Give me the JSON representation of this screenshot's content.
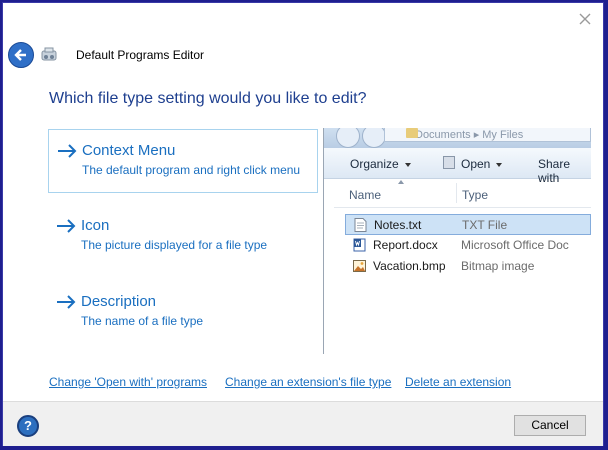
{
  "window": {
    "title": "Default Programs Editor",
    "heading": "Which file type setting would you like to edit?"
  },
  "options": [
    {
      "title": "Context Menu",
      "desc": "The default program and right click menu"
    },
    {
      "title": "Icon",
      "desc": "The picture displayed for a file type"
    },
    {
      "title": "Description",
      "desc": "The name of a file type"
    }
  ],
  "preview": {
    "address": "Documents ▸ My Files",
    "toolbar": {
      "organize": "Organize",
      "open": "Open",
      "share": "Share with"
    },
    "columns": {
      "name": "Name",
      "type": "Type"
    },
    "files": [
      {
        "name": "Notes.txt",
        "type": "TXT File",
        "icon": "text-file-icon"
      },
      {
        "name": "Report.docx",
        "type": "Microsoft Office Doc",
        "icon": "word-doc-icon"
      },
      {
        "name": "Vacation.bmp",
        "type": "Bitmap image",
        "icon": "bitmap-image-icon"
      }
    ]
  },
  "links": {
    "open_with": "Change 'Open with' programs",
    "extension_type": "Change an extension's file type",
    "delete_ext": "Delete an extension"
  },
  "footer": {
    "help": "?",
    "cancel": "Cancel"
  },
  "colors": {
    "accent": "#1a6fc0",
    "heading": "#1e3f8f",
    "selection": "#cde2f6"
  }
}
